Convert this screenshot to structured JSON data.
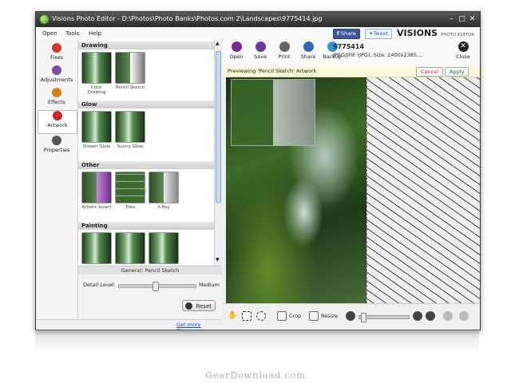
{
  "window": {
    "title": "Visions Photo Editor - D:\\Photos\\Photo Banks\\Photos.com 2\\Landscapes\\9775414.jpg"
  },
  "menu": {
    "items": [
      "Open",
      "Tools",
      "Help"
    ]
  },
  "social": {
    "share": "Share",
    "tweet": "Tweet"
  },
  "logo": {
    "main": "VISIONS",
    "sub": "PHOTO EDITOR"
  },
  "sidenav": {
    "items": [
      {
        "label": "Fixes",
        "icon": "fixes-icon",
        "color": "#d33a2c"
      },
      {
        "label": "Adjustments",
        "icon": "adjustments-icon",
        "color": "#7a4fa8"
      },
      {
        "label": "Effects",
        "icon": "effects-icon",
        "color": "#e07a12"
      },
      {
        "label": "Artwork",
        "icon": "artwork-icon",
        "color": "#c8262a"
      },
      {
        "label": "Properties",
        "icon": "properties-icon",
        "color": "#555555"
      }
    ]
  },
  "filters": {
    "sections": [
      {
        "title": "Drawing",
        "items": [
          "Color Drawing",
          "Pencil Sketch"
        ]
      },
      {
        "title": "Glow",
        "items": [
          "Dream Glow",
          "Sunny Glow"
        ]
      },
      {
        "title": "Other",
        "items": [
          "Artistic Invert",
          "Tiles",
          "X-Ray"
        ]
      },
      {
        "title": "Painting",
        "items": []
      }
    ]
  },
  "general": {
    "title": "General: Pencil Sketch",
    "detail_label": "Detail Level:",
    "detail_value": "Medium",
    "reset_label": "Reset"
  },
  "statusbar": {
    "more_link": "Get more filters..."
  },
  "toolbar": {
    "items": [
      {
        "label": "Open",
        "icon": "open-icon",
        "color": "#7a2a8a"
      },
      {
        "label": "Save",
        "icon": "save-icon",
        "color": "#6a3a9a"
      },
      {
        "label": "Print",
        "icon": "print-icon",
        "color": "#666666"
      },
      {
        "label": "Share",
        "icon": "share-icon",
        "color": "#2a6ab8"
      },
      {
        "label": "Backup",
        "icon": "backup-icon",
        "color": "#2a9ad8"
      }
    ],
    "close_label": "Close"
  },
  "fileinfo": {
    "name": "9775414",
    "details": "JPEG/JFIF (JPG), Size: 2400x2385,..."
  },
  "preview": {
    "text": "Previewing 'Pencil Sketch' Artwork",
    "cancel": "Cancel",
    "apply": "Apply"
  },
  "bottombar": {
    "crop": "Crop",
    "resize": "Resize"
  },
  "watermark": "GearDownload.com"
}
